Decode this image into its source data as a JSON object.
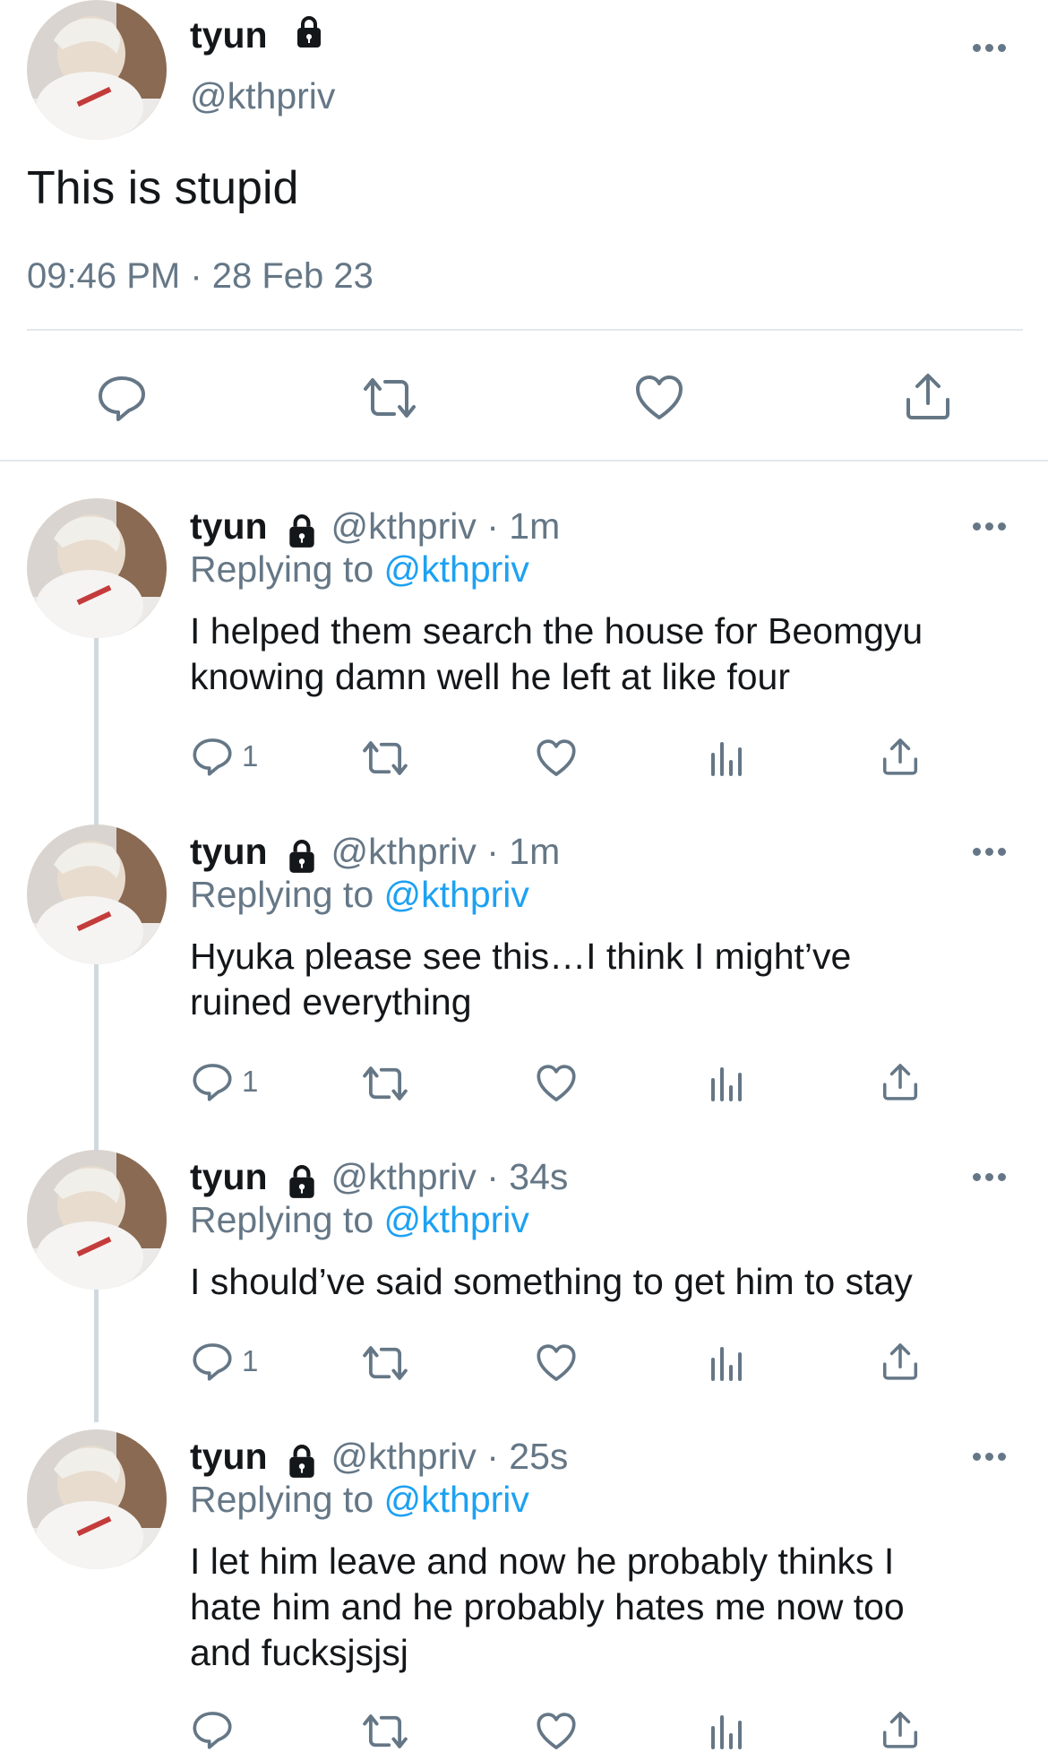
{
  "main_tweet": {
    "display_name": "tyun",
    "handle": "@kthpriv",
    "text": "This is stupid",
    "timestamp": "09:46 PM · 28 Feb 23",
    "actions": [
      "reply-icon",
      "retweet-icon",
      "like-icon",
      "share-icon"
    ]
  },
  "replies": [
    {
      "display_name": "tyun",
      "handle_time": "@kthpriv · 1m",
      "replying_prefix": "Replying to",
      "replying_to": "@kthpriv",
      "lines": [
        "I helped them search the house for Beomgyu",
        "knowing damn well he left at like four"
      ],
      "reply_count": "1"
    },
    {
      "display_name": "tyun",
      "handle_time": "@kthpriv · 1m",
      "replying_prefix": "Replying to",
      "replying_to": "@kthpriv",
      "lines": [
        "Hyuka please see this…I think I might’ve",
        "ruined everything"
      ],
      "reply_count": "1"
    },
    {
      "display_name": "tyun",
      "handle_time": "@kthpriv · 34s",
      "replying_prefix": "Replying to",
      "replying_to": "@kthpriv",
      "lines": [
        "I should’ve said something to get him to stay"
      ],
      "reply_count": "1"
    },
    {
      "display_name": "tyun",
      "handle_time": "@kthpriv · 25s",
      "replying_prefix": "Replying to",
      "replying_to": "@kthpriv",
      "lines": [
        "I let him leave and now he probably thinks I",
        "hate him and he probably hates me now too",
        "and fucksjsjsj"
      ],
      "reply_count": ""
    }
  ],
  "colors": {
    "accent": "#1da1f2",
    "secondary": "#657786",
    "text": "#14171a",
    "divider": "#e1e8ed"
  }
}
